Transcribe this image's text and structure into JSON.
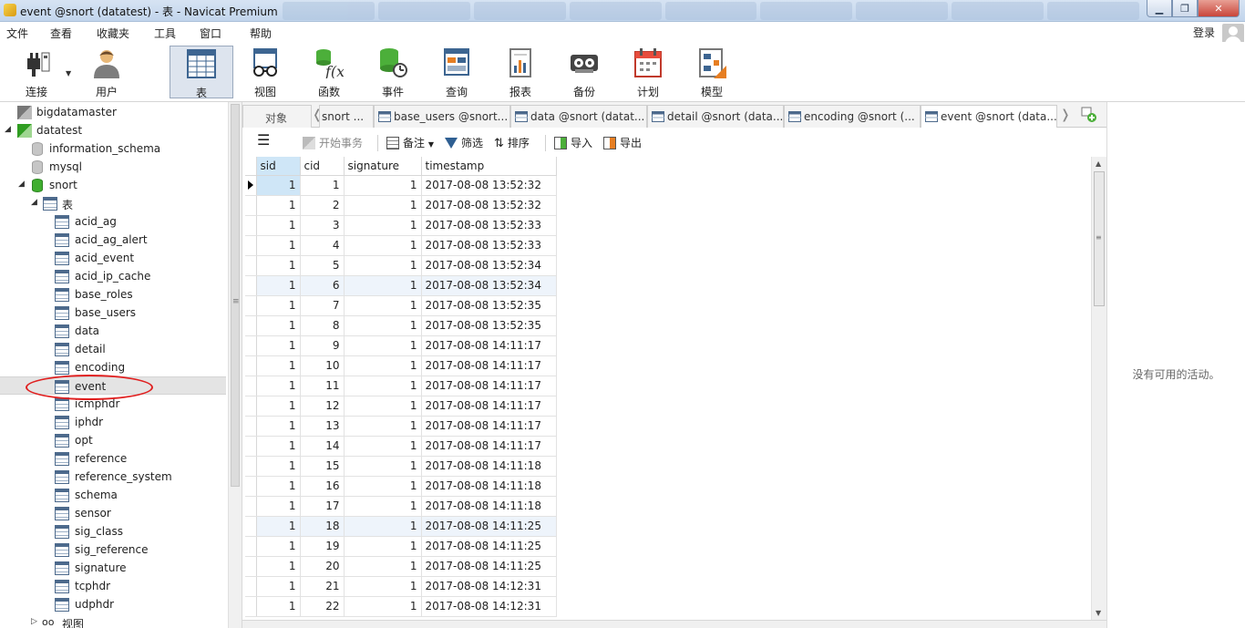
{
  "window": {
    "title": "event @snort (datatest) - 表 - Navicat Premium"
  },
  "menu": {
    "items": [
      "文件",
      "查看",
      "收藏夹",
      "工具",
      "窗口",
      "帮助"
    ],
    "login_label": "登录"
  },
  "toolbar": {
    "items": [
      {
        "label": "连接",
        "icon": "plug-icon"
      },
      {
        "label": "用户",
        "icon": "user-icon"
      },
      {
        "label": "表",
        "icon": "table-icon",
        "active": true
      },
      {
        "label": "视图",
        "icon": "glasses-icon"
      },
      {
        "label": "函数",
        "icon": "function-icon"
      },
      {
        "label": "事件",
        "icon": "event-clock-icon"
      },
      {
        "label": "查询",
        "icon": "query-icon"
      },
      {
        "label": "报表",
        "icon": "report-icon"
      },
      {
        "label": "备份",
        "icon": "backup-icon"
      },
      {
        "label": "计划",
        "icon": "calendar-icon"
      },
      {
        "label": "模型",
        "icon": "model-icon"
      }
    ]
  },
  "nav": {
    "connections": [
      {
        "label": "bigdatamaster"
      },
      {
        "label": "datatest"
      }
    ],
    "databases": [
      {
        "label": "information_schema"
      },
      {
        "label": "mysql"
      },
      {
        "label": "snort"
      }
    ],
    "tables_group_label": "表",
    "tables": [
      "acid_ag",
      "acid_ag_alert",
      "acid_event",
      "acid_ip_cache",
      "base_roles",
      "base_users",
      "data",
      "detail",
      "encoding",
      "event",
      "icmphdr",
      "iphdr",
      "opt",
      "reference",
      "reference_system",
      "schema",
      "sensor",
      "sig_class",
      "sig_reference",
      "signature",
      "tcphdr",
      "udphdr"
    ],
    "selected_table": "event",
    "views_group_label": "视图"
  },
  "tabs": {
    "objects_label": "对象",
    "items": [
      {
        "label": "snort ..."
      },
      {
        "label": "base_users @snort..."
      },
      {
        "label": "data @snort (datat..."
      },
      {
        "label": "detail @snort (data..."
      },
      {
        "label": "encoding @snort (..."
      },
      {
        "label": "event @snort (data...",
        "active": true
      }
    ]
  },
  "gridbar": {
    "begin_transaction": "开始事务",
    "memo": "备注",
    "filter": "筛选",
    "sort": "排序",
    "import": "导入",
    "export": "导出"
  },
  "grid": {
    "columns": [
      "sid",
      "cid",
      "signature",
      "timestamp"
    ],
    "rows": [
      [
        "1",
        "1",
        "1",
        "2017-08-08 13:52:32"
      ],
      [
        "1",
        "2",
        "1",
        "2017-08-08 13:52:32"
      ],
      [
        "1",
        "3",
        "1",
        "2017-08-08 13:52:33"
      ],
      [
        "1",
        "4",
        "1",
        "2017-08-08 13:52:33"
      ],
      [
        "1",
        "5",
        "1",
        "2017-08-08 13:52:34"
      ],
      [
        "1",
        "6",
        "1",
        "2017-08-08 13:52:34"
      ],
      [
        "1",
        "7",
        "1",
        "2017-08-08 13:52:35"
      ],
      [
        "1",
        "8",
        "1",
        "2017-08-08 13:52:35"
      ],
      [
        "1",
        "9",
        "1",
        "2017-08-08 14:11:17"
      ],
      [
        "1",
        "10",
        "1",
        "2017-08-08 14:11:17"
      ],
      [
        "1",
        "11",
        "1",
        "2017-08-08 14:11:17"
      ],
      [
        "1",
        "12",
        "1",
        "2017-08-08 14:11:17"
      ],
      [
        "1",
        "13",
        "1",
        "2017-08-08 14:11:17"
      ],
      [
        "1",
        "14",
        "1",
        "2017-08-08 14:11:17"
      ],
      [
        "1",
        "15",
        "1",
        "2017-08-08 14:11:18"
      ],
      [
        "1",
        "16",
        "1",
        "2017-08-08 14:11:18"
      ],
      [
        "1",
        "17",
        "1",
        "2017-08-08 14:11:18"
      ],
      [
        "1",
        "18",
        "1",
        "2017-08-08 14:11:25"
      ],
      [
        "1",
        "19",
        "1",
        "2017-08-08 14:11:25"
      ],
      [
        "1",
        "20",
        "1",
        "2017-08-08 14:11:25"
      ],
      [
        "1",
        "21",
        "1",
        "2017-08-08 14:12:31"
      ],
      [
        "1",
        "22",
        "1",
        "2017-08-08 14:12:31"
      ]
    ]
  },
  "info_panel": {
    "message": "没有可用的活动。"
  },
  "colors": {
    "selection": "#cfe6f7",
    "annotation": "#e02020",
    "db_active": "#3fae2f"
  }
}
